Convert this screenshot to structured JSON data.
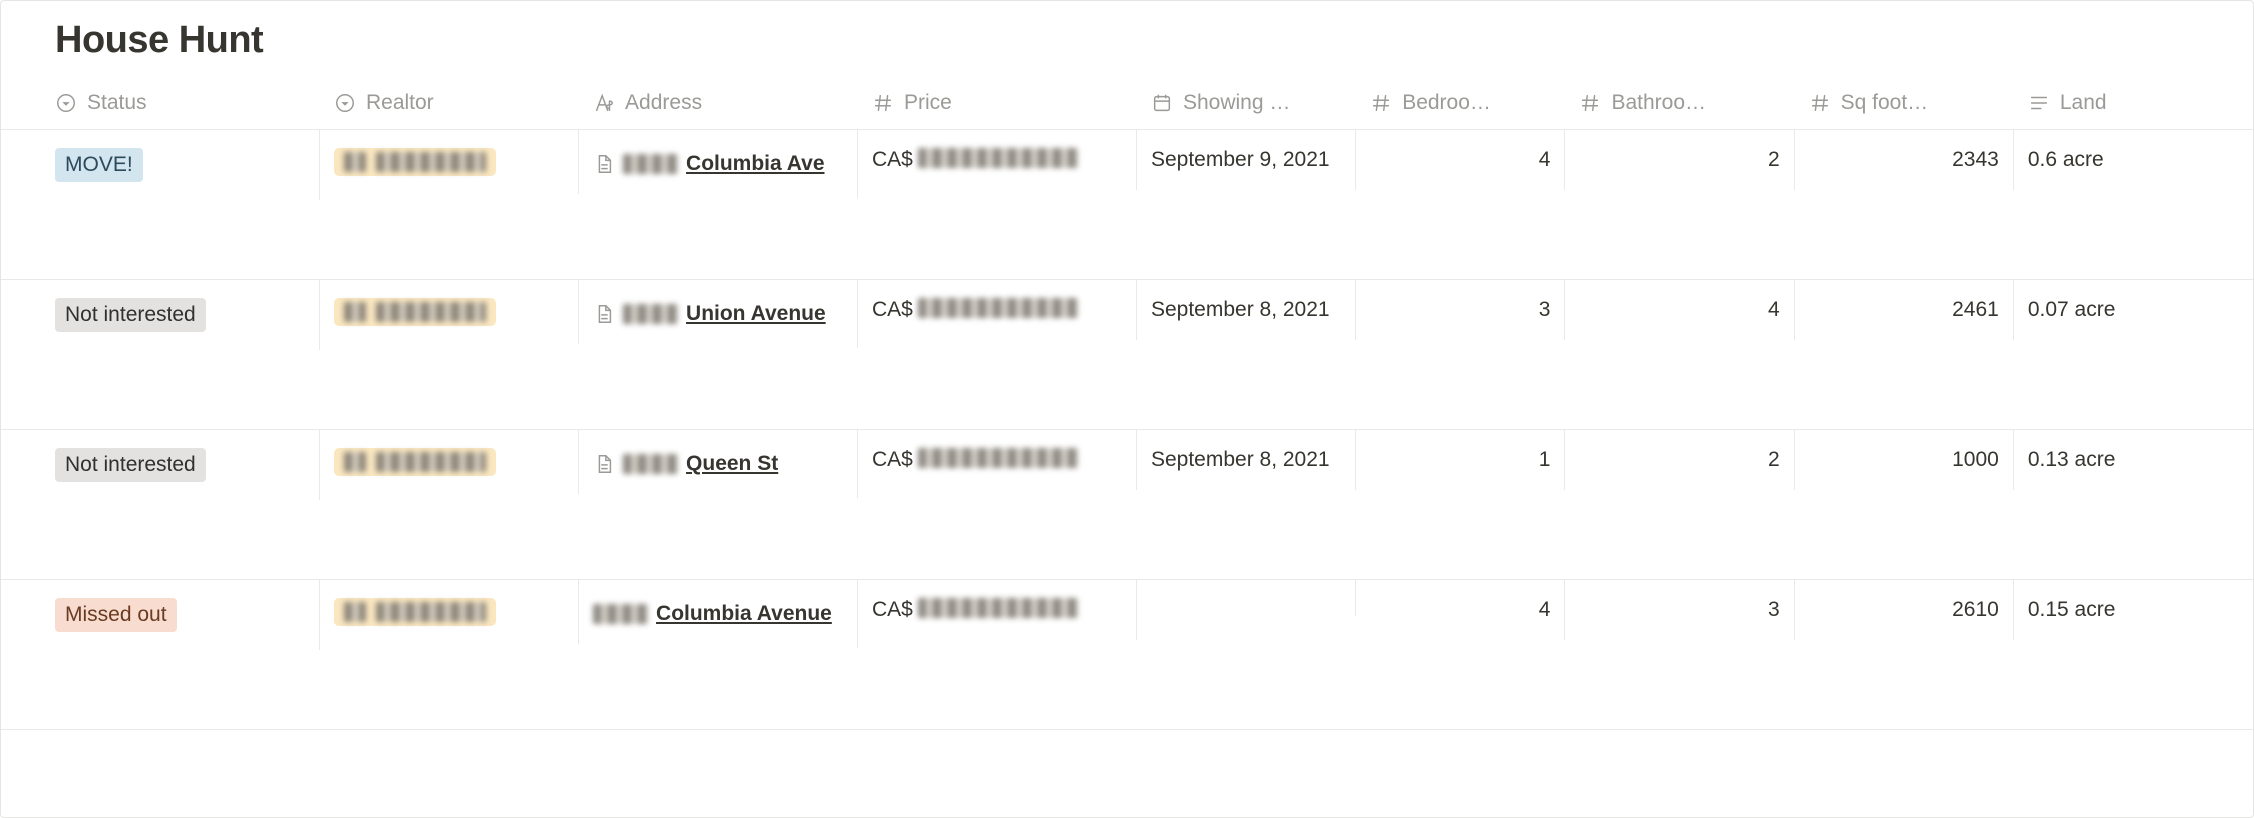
{
  "title": "House Hunt",
  "columns": {
    "status": "Status",
    "realtor": "Realtor",
    "address": "Address",
    "price": "Price",
    "showing": "Showing …",
    "bedrooms": "Bedroo…",
    "bathrooms": "Bathroo…",
    "sqft": "Sq foot…",
    "land": "Land"
  },
  "status_colors": {
    "MOVE!": "tag-blue",
    "Not interested": "tag-gray",
    "Missed out": "tag-orange"
  },
  "rows": [
    {
      "status": "MOVE!",
      "realtor_redacted": true,
      "address_prefix_redacted": true,
      "address_text": "Columbia Ave",
      "has_page_icon": true,
      "price_prefix": "CA$",
      "price_redacted": true,
      "showing": "September 9, 2021",
      "bedrooms": "4",
      "bathrooms": "2",
      "sqft": "2343",
      "land": "0.6 acre"
    },
    {
      "status": "Not interested",
      "realtor_redacted": true,
      "address_prefix_redacted": true,
      "address_text": "Union Avenue",
      "has_page_icon": true,
      "price_prefix": "CA$",
      "price_redacted": true,
      "showing": "September 8, 2021",
      "bedrooms": "3",
      "bathrooms": "4",
      "sqft": "2461",
      "land": "0.07 acre"
    },
    {
      "status": "Not interested",
      "realtor_redacted": true,
      "address_prefix_redacted": true,
      "address_text": "Queen St",
      "has_page_icon": true,
      "price_prefix": "CA$",
      "price_redacted": true,
      "showing": "September 8, 2021",
      "bedrooms": "1",
      "bathrooms": "2",
      "sqft": "1000",
      "land": "0.13 acre"
    },
    {
      "status": "Missed out",
      "realtor_redacted": true,
      "address_prefix_redacted": true,
      "address_text": "Columbia Avenue",
      "has_page_icon": false,
      "price_prefix": "CA$",
      "price_redacted": true,
      "showing": "",
      "bedrooms": "4",
      "bathrooms": "3",
      "sqft": "2610",
      "land": "0.15 acre"
    }
  ]
}
